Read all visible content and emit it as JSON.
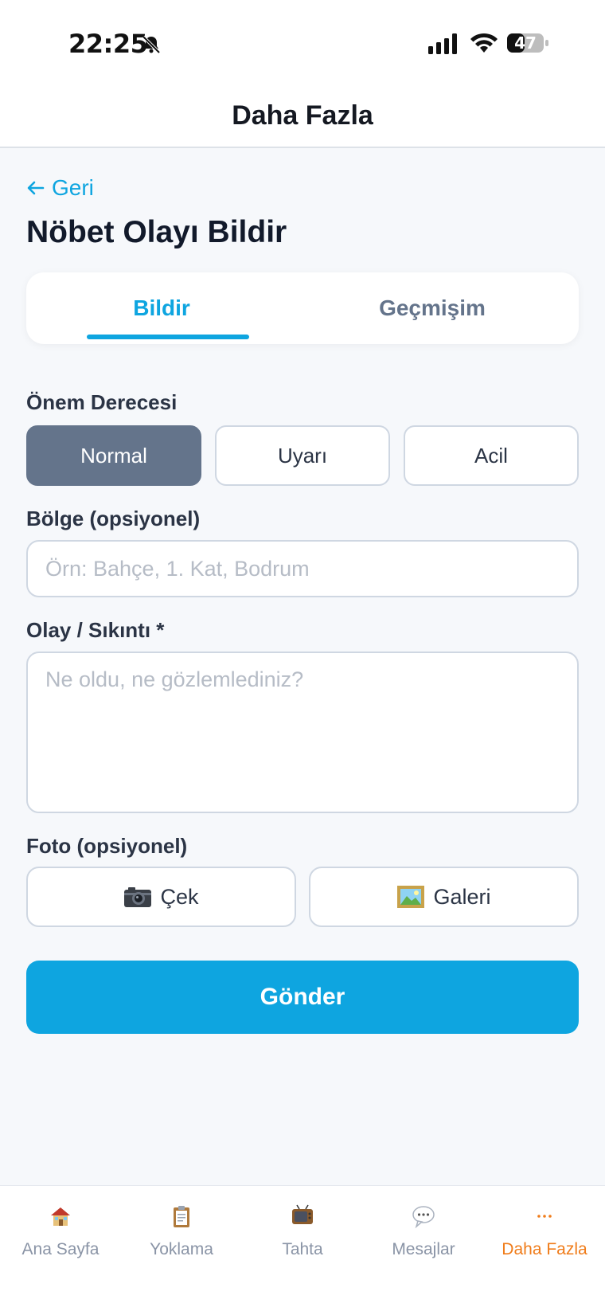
{
  "status_bar": {
    "time": "22:25",
    "battery": "47"
  },
  "header": {
    "title": "Daha Fazla"
  },
  "page": {
    "back_label": "Geri",
    "title": "Nöbet Olayı Bildir"
  },
  "tabs": [
    {
      "label": "Bildir",
      "active": true
    },
    {
      "label": "Geçmişim",
      "active": false
    }
  ],
  "form": {
    "severity": {
      "label": "Önem Derecesi",
      "options": [
        "Normal",
        "Uyarı",
        "Acil"
      ],
      "selected": "Normal"
    },
    "region": {
      "label": "Bölge (opsiyonel)",
      "placeholder": "Örn: Bahçe, 1. Kat, Bodrum"
    },
    "incident": {
      "label": "Olay / Sıkıntı *",
      "placeholder": "Ne oldu, ne gözlemlediniz?"
    },
    "photo": {
      "label": "Foto (opsiyonel)",
      "camera_label": "Çek",
      "gallery_label": "Galeri"
    },
    "submit_label": "Gönder"
  },
  "bottom_nav": [
    {
      "label": "Ana Sayfa",
      "icon": "house-icon",
      "active": false
    },
    {
      "label": "Yoklama",
      "icon": "clipboard-icon",
      "active": false
    },
    {
      "label": "Tahta",
      "icon": "tv-icon",
      "active": false
    },
    {
      "label": "Mesajlar",
      "icon": "speech-bubble-icon",
      "active": false
    },
    {
      "label": "Daha Fazla",
      "icon": "more-dots-icon",
      "active": true
    }
  ],
  "colors": {
    "accent": "#0ea5e0",
    "active_nav": "#f07c1a",
    "selected_severity": "#64748b"
  }
}
